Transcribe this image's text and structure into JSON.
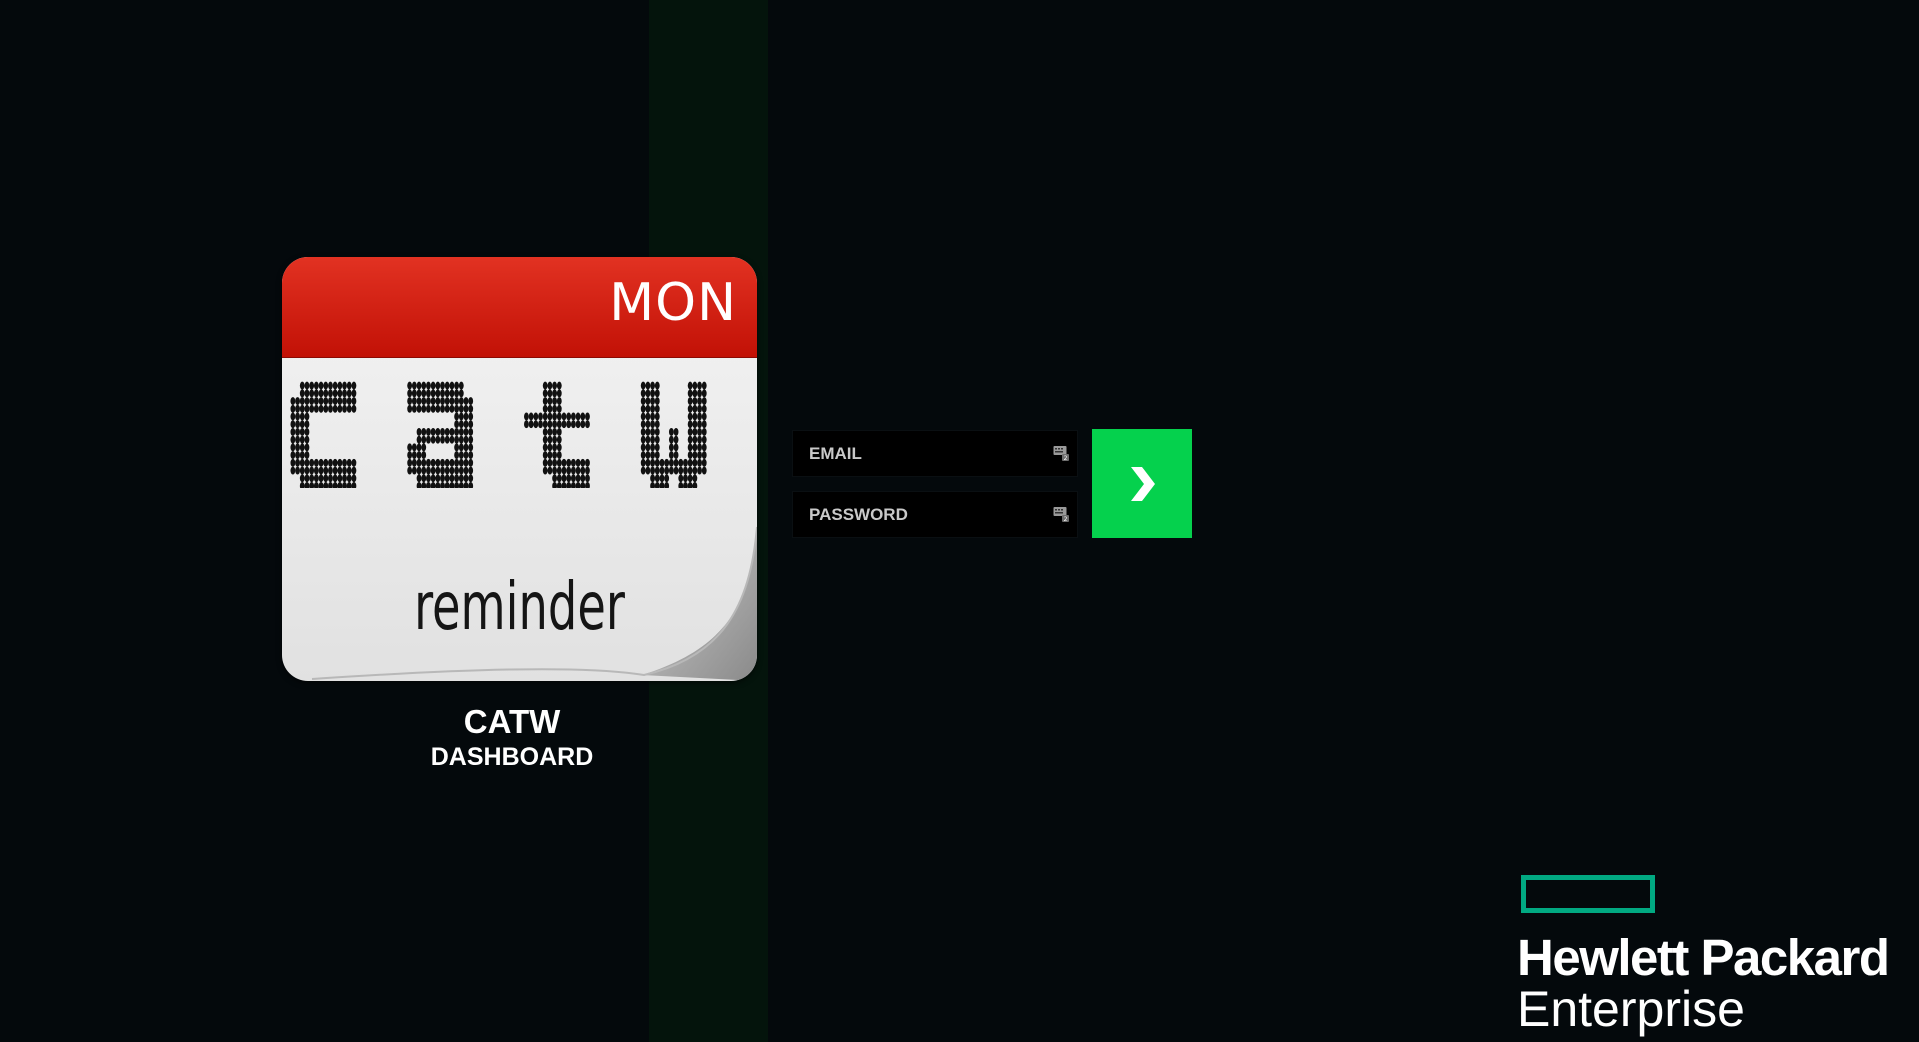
{
  "logo": {
    "day": "MON",
    "brand_text": "CATW",
    "tagline": "reminder"
  },
  "app": {
    "name": "CATW",
    "subtitle": "DASHBOARD"
  },
  "login": {
    "email_placeholder": "EMAIL",
    "password_placeholder": "PASSWORD",
    "field_icon": "keyboard-icon",
    "submit_icon": "chevron-right-icon"
  },
  "company": {
    "line1": "Hewlett Packard",
    "line2": "Enterprise"
  },
  "colors": {
    "background": "#04090c",
    "accent_strip": "#04140c",
    "calendar_header": "#c81a0c",
    "submit_button": "#05d14d",
    "hpe_green": "#01a982"
  }
}
